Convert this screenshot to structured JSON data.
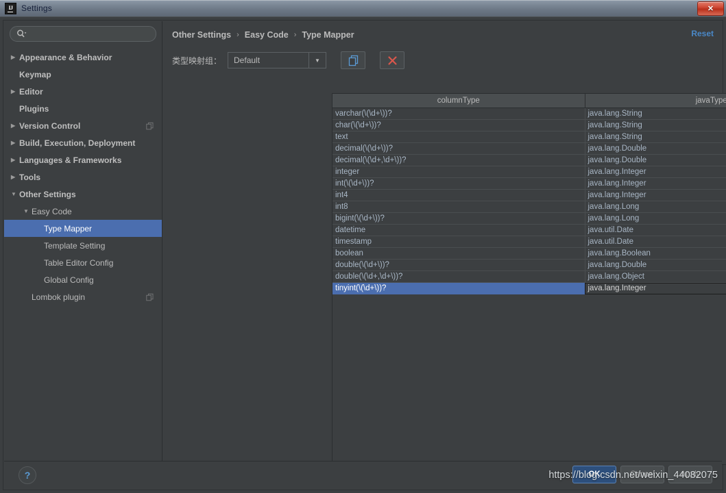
{
  "window": {
    "title": "Settings",
    "app_icon": "intellij-idea-icon",
    "close_label": "✕"
  },
  "search": {
    "value": "",
    "placeholder": "",
    "icon": "search-icon"
  },
  "sidebar": {
    "items": [
      {
        "label": "Appearance & Behavior",
        "arrow": "▶",
        "depth": 1,
        "bold": true,
        "selected": false,
        "gutter_icon": ""
      },
      {
        "label": "Keymap",
        "arrow": "",
        "depth": 1,
        "bold": true,
        "selected": false,
        "gutter_icon": ""
      },
      {
        "label": "Editor",
        "arrow": "▶",
        "depth": 1,
        "bold": true,
        "selected": false,
        "gutter_icon": ""
      },
      {
        "label": "Plugins",
        "arrow": "",
        "depth": 1,
        "bold": true,
        "selected": false,
        "gutter_icon": ""
      },
      {
        "label": "Version Control",
        "arrow": "▶",
        "depth": 1,
        "bold": true,
        "selected": false,
        "gutter_icon": "copy-icon"
      },
      {
        "label": "Build, Execution, Deployment",
        "arrow": "▶",
        "depth": 1,
        "bold": true,
        "selected": false,
        "gutter_icon": ""
      },
      {
        "label": "Languages & Frameworks",
        "arrow": "▶",
        "depth": 1,
        "bold": true,
        "selected": false,
        "gutter_icon": ""
      },
      {
        "label": "Tools",
        "arrow": "▶",
        "depth": 1,
        "bold": true,
        "selected": false,
        "gutter_icon": ""
      },
      {
        "label": "Other Settings",
        "arrow": "▼",
        "depth": 1,
        "bold": true,
        "selected": false,
        "gutter_icon": ""
      },
      {
        "label": "Easy Code",
        "arrow": "▼",
        "depth": 2,
        "bold": false,
        "selected": false,
        "gutter_icon": ""
      },
      {
        "label": "Type Mapper",
        "arrow": "",
        "depth": 3,
        "bold": false,
        "selected": true,
        "gutter_icon": ""
      },
      {
        "label": "Template Setting",
        "arrow": "",
        "depth": 3,
        "bold": false,
        "selected": false,
        "gutter_icon": ""
      },
      {
        "label": "Table Editor Config",
        "arrow": "",
        "depth": 3,
        "bold": false,
        "selected": false,
        "gutter_icon": ""
      },
      {
        "label": "Global Config",
        "arrow": "",
        "depth": 3,
        "bold": false,
        "selected": false,
        "gutter_icon": ""
      },
      {
        "label": "Lombok plugin",
        "arrow": "",
        "depth": 2,
        "bold": false,
        "selected": false,
        "gutter_icon": "copy-icon"
      }
    ]
  },
  "breadcrumb": {
    "items": [
      "Other Settings",
      "Easy Code",
      "Type Mapper"
    ],
    "separator": "›"
  },
  "reset": {
    "label": "Reset"
  },
  "toolbar": {
    "group_label": "类型映射组：",
    "group_value": "Default",
    "group_options": [
      "Default"
    ],
    "copy_icon": "copy-pages-icon",
    "delete_icon": "close-x-icon"
  },
  "table": {
    "columns": [
      "columnType",
      "javaType"
    ],
    "rows": [
      {
        "columnType": "varchar(\\(\\d+\\))?",
        "javaType": "java.lang.String",
        "selected": false
      },
      {
        "columnType": "char(\\(\\d+\\))?",
        "javaType": "java.lang.String",
        "selected": false
      },
      {
        "columnType": "text",
        "javaType": "java.lang.String",
        "selected": false
      },
      {
        "columnType": "decimal(\\(\\d+\\))?",
        "javaType": "java.lang.Double",
        "selected": false
      },
      {
        "columnType": "decimal(\\(\\d+,\\d+\\))?",
        "javaType": "java.lang.Double",
        "selected": false
      },
      {
        "columnType": "integer",
        "javaType": "java.lang.Integer",
        "selected": false
      },
      {
        "columnType": "int(\\(\\d+\\))?",
        "javaType": "java.lang.Integer",
        "selected": false
      },
      {
        "columnType": "int4",
        "javaType": "java.lang.Integer",
        "selected": false
      },
      {
        "columnType": "int8",
        "javaType": "java.lang.Long",
        "selected": false
      },
      {
        "columnType": "bigint(\\(\\d+\\))?",
        "javaType": "java.lang.Long",
        "selected": false
      },
      {
        "columnType": "datetime",
        "javaType": "java.util.Date",
        "selected": false
      },
      {
        "columnType": "timestamp",
        "javaType": "java.util.Date",
        "selected": false
      },
      {
        "columnType": "boolean",
        "javaType": "java.lang.Boolean",
        "selected": false
      },
      {
        "columnType": "double(\\(\\d+\\))?",
        "javaType": "java.lang.Double",
        "selected": false
      },
      {
        "columnType": "double(\\(\\d+,\\d+\\))?",
        "javaType": "java.lang.Object",
        "selected": false
      },
      {
        "columnType": "tinyint(\\(\\d+\\))?",
        "javaType": "java.lang.Integer",
        "selected": true
      }
    ]
  },
  "side_buttons": {
    "add_label": "+",
    "add_icon": "plus-icon",
    "remove_label": "✕",
    "remove_icon": "close-x-icon"
  },
  "footer": {
    "help_label": "?",
    "help_icon": "question-mark-icon",
    "ok_label": "OK",
    "cancel_label": "Cancel",
    "apply_label": "Apply"
  },
  "watermark": {
    "text": "https://blog.csdn.net/weixin_44082075"
  },
  "colors": {
    "accent_selection": "#4b6eaf",
    "link": "#4a88c7",
    "add_green": "#5fa65f",
    "remove_red": "#d9574c",
    "panel_bg": "#3c3f41",
    "text": "#bbbbbb",
    "table_text": "#a9b7c6"
  }
}
